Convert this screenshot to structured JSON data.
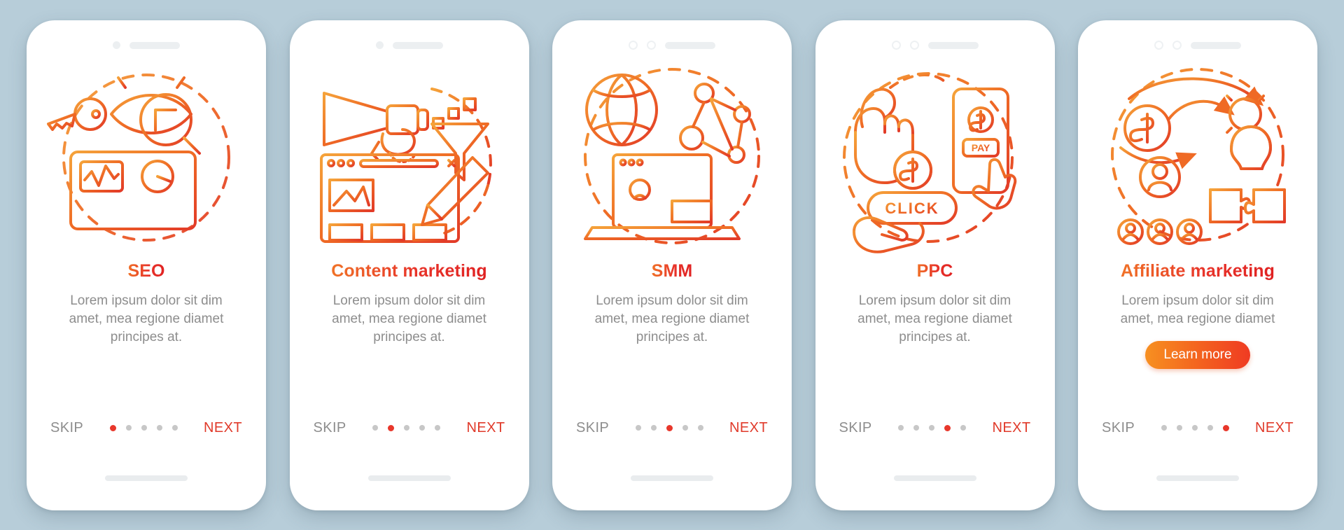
{
  "theme": {
    "background": "#b7cdd9",
    "card_bg": "#ffffff",
    "accent_red": "#e8372b",
    "accent_orange": "#f79021",
    "muted_text": "#8d8d8d",
    "dot_inactive": "#c7c7c7"
  },
  "common": {
    "skip_label": "SKIP",
    "next_label": "NEXT",
    "dot_count": 5
  },
  "screens": [
    {
      "id": "seo",
      "title": "SEO",
      "description": "Lorem ipsum dolor sit dim amet, mea regione diamet principes at.",
      "skip_label": "SKIP",
      "next_label": "NEXT",
      "active_dot": 1,
      "camera_style": "dot",
      "cta_label": null,
      "illustration": "seo-illustration",
      "illustration_parts": [
        "key-icon",
        "eye-icon",
        "magnifier-icon",
        "monitor-analytics-icon",
        "dashed-circle"
      ]
    },
    {
      "id": "content-marketing",
      "title": "Content marketing",
      "description": "Lorem ipsum dolor sit dim amet, mea regione diamet principes at.",
      "skip_label": "SKIP",
      "next_label": "NEXT",
      "active_dot": 2,
      "camera_style": "dot",
      "cta_label": null,
      "illustration": "content-marketing-illustration",
      "illustration_parts": [
        "megaphone-icon",
        "hand-icon",
        "funnel-icon",
        "browser-page-icon",
        "pencil-icon"
      ]
    },
    {
      "id": "smm",
      "title": "SMM",
      "description": "Lorem ipsum dolor sit dim amet, mea regione diamet principes at.",
      "skip_label": "SKIP",
      "next_label": "NEXT",
      "active_dot": 3,
      "camera_style": "rings",
      "cta_label": null,
      "illustration": "smm-illustration",
      "illustration_parts": [
        "globe-icon",
        "network-nodes-icon",
        "laptop-icon",
        "dashed-circle"
      ]
    },
    {
      "id": "ppc",
      "title": "PPC",
      "description": "Lorem ipsum dolor sit dim amet, mea regione diamet principes at.",
      "skip_label": "SKIP",
      "next_label": "NEXT",
      "active_dot": 4,
      "camera_style": "rings",
      "cta_label": null,
      "illustration": "ppc-illustration",
      "illustration_parts": [
        "hand-click-icon",
        "smartphone-pay-icon",
        "click-button-icon",
        "coin-dollar-icon",
        "open-hand-icon",
        "dashed-circle"
      ],
      "illustration_labels": {
        "click": "CLICK",
        "pay": "PAY",
        "dollar": "$"
      }
    },
    {
      "id": "affiliate-marketing",
      "title": "Affiliate marketing",
      "description": "Lorem ipsum dolor sit dim amet, mea regione diamet",
      "skip_label": "SKIP",
      "next_label": "NEXT",
      "active_dot": 5,
      "camera_style": "rings",
      "cta_label": "Learn more",
      "illustration": "affiliate-marketing-illustration",
      "illustration_parts": [
        "coin-dollar-icon",
        "gear-bulb-icon",
        "avatar-icon",
        "org-chart-icon",
        "puzzle-icon",
        "circular-arrows-icon"
      ],
      "illustration_labels": {
        "dollar": "$"
      }
    }
  ]
}
